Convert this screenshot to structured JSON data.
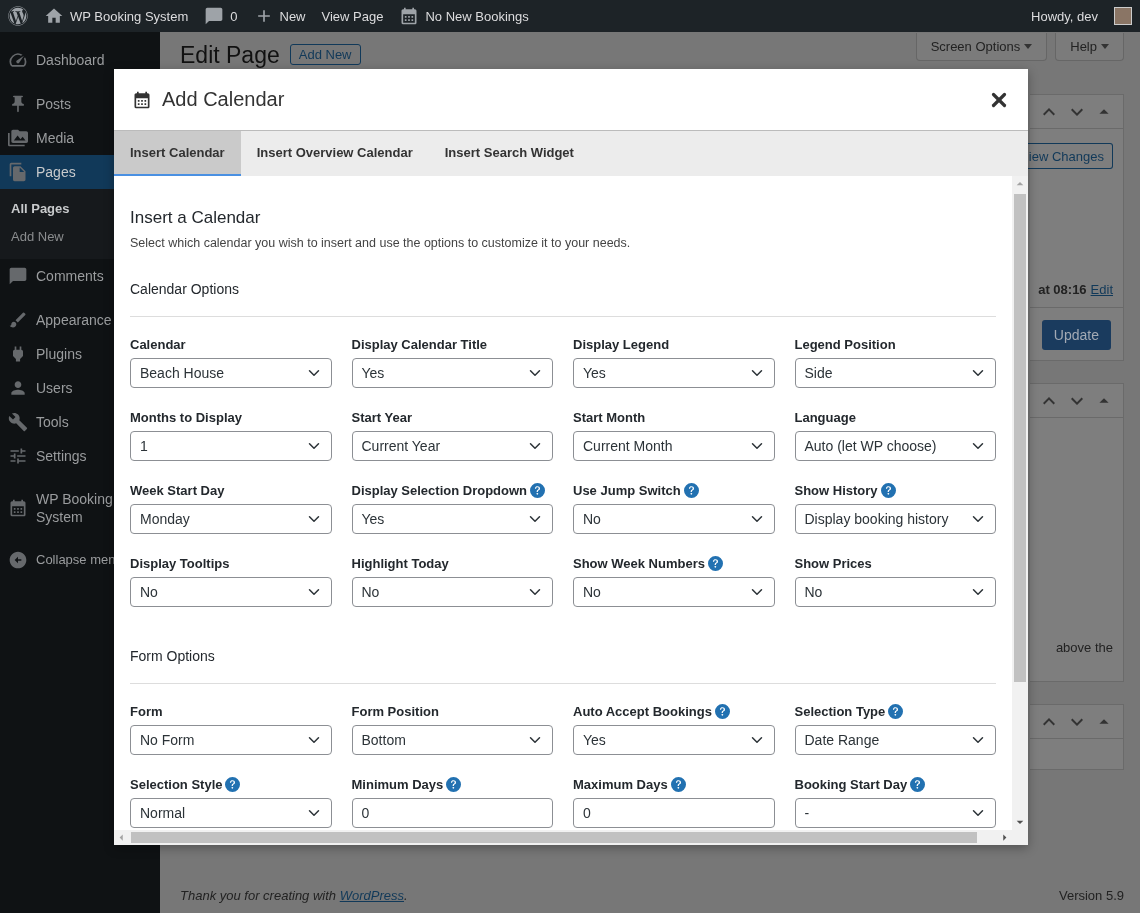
{
  "admin_bar": {
    "items": [
      {
        "label": "WP Booking System"
      },
      {
        "label": "0"
      },
      {
        "label": "New"
      },
      {
        "label": "View Page"
      },
      {
        "label": "No New Bookings"
      }
    ],
    "greeting": "Howdy, dev"
  },
  "sidebar": {
    "groups": [
      [
        {
          "label": "Dashboard",
          "selected": false
        }
      ],
      [
        {
          "label": "Posts",
          "selected": false
        },
        {
          "label": "Media",
          "selected": false
        },
        {
          "label": "Pages",
          "selected": true,
          "children": [
            {
              "label": "All Pages",
              "selected": true
            },
            {
              "label": "Add New",
              "selected": false
            }
          ]
        },
        {
          "label": "Comments",
          "selected": false
        }
      ],
      [
        {
          "label": "Appearance",
          "selected": false
        },
        {
          "label": "Plugins",
          "selected": false
        },
        {
          "label": "Users",
          "selected": false
        },
        {
          "label": "Tools",
          "selected": false
        },
        {
          "label": "Settings",
          "selected": false
        }
      ],
      [
        {
          "label": "WP Booking System",
          "selected": false
        }
      ]
    ],
    "collapse": "Collapse men"
  },
  "page": {
    "title": "Edit Page",
    "add_new": "Add New",
    "screen_options": "Screen Options",
    "help": "Help",
    "preview_button": "iew Changes",
    "published_time": "at 08:16",
    "edit_link": "Edit",
    "update_button": "Update",
    "note": "above the"
  },
  "footer": {
    "thanks": "Thank you for creating with",
    "link": "WordPress",
    "end": ".",
    "version": "Version 5.9"
  },
  "modal": {
    "title": "Add Calendar",
    "tabs": [
      {
        "label": "Insert Calendar",
        "selected": true
      },
      {
        "label": "Insert Overview Calendar",
        "selected": false
      },
      {
        "label": "Insert Search Widget",
        "selected": false
      }
    ],
    "heading": "Insert a Calendar",
    "description": "Select which calendar you wish to insert and use the options to customize it to your needs.",
    "sections": [
      {
        "title": "Calendar Options",
        "fields": [
          {
            "label": "Calendar",
            "help": false,
            "kind": "select",
            "value": "Beach House"
          },
          {
            "label": "Display Calendar Title",
            "help": false,
            "kind": "select",
            "value": "Yes"
          },
          {
            "label": "Display Legend",
            "help": false,
            "kind": "select",
            "value": "Yes"
          },
          {
            "label": "Legend Position",
            "help": false,
            "kind": "select",
            "value": "Side"
          },
          {
            "label": "Months to Display",
            "help": false,
            "kind": "select",
            "value": "1"
          },
          {
            "label": "Start Year",
            "help": false,
            "kind": "select",
            "value": "Current Year"
          },
          {
            "label": "Start Month",
            "help": false,
            "kind": "select",
            "value": "Current Month"
          },
          {
            "label": "Language",
            "help": false,
            "kind": "select",
            "value": "Auto (let WP choose)"
          },
          {
            "label": "Week Start Day",
            "help": false,
            "kind": "select",
            "value": "Monday"
          },
          {
            "label": "Display Selection Dropdown",
            "help": true,
            "kind": "select",
            "value": "Yes"
          },
          {
            "label": "Use Jump Switch",
            "help": true,
            "kind": "select",
            "value": "No"
          },
          {
            "label": "Show History",
            "help": true,
            "kind": "select",
            "value": "Display booking history"
          },
          {
            "label": "Display Tooltips",
            "help": false,
            "kind": "select",
            "value": "No"
          },
          {
            "label": "Highlight Today",
            "help": false,
            "kind": "select",
            "value": "No"
          },
          {
            "label": "Show Week Numbers",
            "help": true,
            "kind": "select",
            "value": "No"
          },
          {
            "label": "Show Prices",
            "help": false,
            "kind": "select",
            "value": "No"
          }
        ]
      },
      {
        "title": "Form Options",
        "fields": [
          {
            "label": "Form",
            "help": false,
            "kind": "select",
            "value": "No Form"
          },
          {
            "label": "Form Position",
            "help": false,
            "kind": "select",
            "value": "Bottom"
          },
          {
            "label": "Auto Accept Bookings",
            "help": true,
            "kind": "select",
            "value": "Yes"
          },
          {
            "label": "Selection Type",
            "help": true,
            "kind": "select",
            "value": "Date Range"
          },
          {
            "label": "Selection Style",
            "help": true,
            "kind": "select",
            "value": "Normal"
          },
          {
            "label": "Minimum Days",
            "help": true,
            "kind": "input",
            "value": "0"
          },
          {
            "label": "Maximum Days",
            "help": true,
            "kind": "input",
            "value": "0"
          },
          {
            "label": "Booking Start Day",
            "help": true,
            "kind": "select",
            "value": "-"
          }
        ]
      }
    ]
  }
}
